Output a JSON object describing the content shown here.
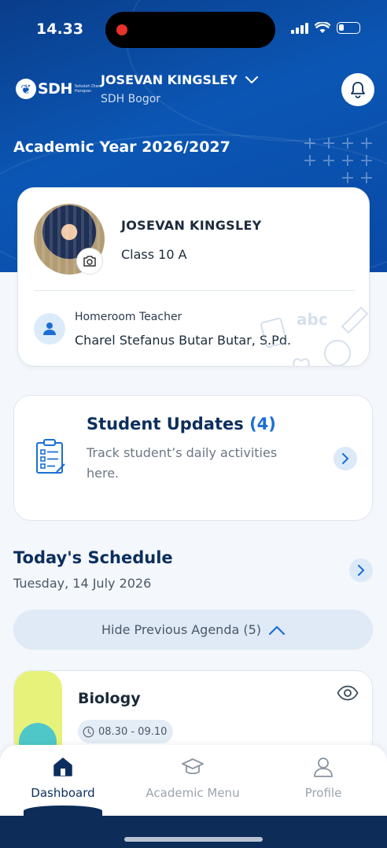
{
  "status_bar": {
    "time": "14.33"
  },
  "header": {
    "school_logo_text": "SDH",
    "school_logo_sub": "Sekolah Dian Harapan",
    "user_name": "JOSEVAN KINGSLEY",
    "school": "SDH Bogor",
    "academic_year": "Academic Year 2026/2027"
  },
  "profile": {
    "name": "JOSEVAN KINGSLEY",
    "class": "Class 10 A",
    "homeroom_label": "Homeroom Teacher",
    "homeroom_teacher": "Charel Stefanus Butar Butar, S.Pd."
  },
  "student_updates": {
    "title": "Student Updates",
    "count": "(4)",
    "description": "Track student’s daily activities here."
  },
  "schedule": {
    "title": "Today's Schedule",
    "date": "Tuesday, 14 July 2026",
    "hide_label": "Hide Previous Agenda (5)",
    "agenda": [
      {
        "subject": "Biology",
        "time": "08.30 - 09.10",
        "accent": "#e7f27a"
      }
    ]
  },
  "bottom_nav": {
    "items": [
      {
        "label": "Dashboard",
        "icon": "home-icon",
        "active": true
      },
      {
        "label": "Academic Menu",
        "icon": "graduation-cap-icon",
        "active": false
      },
      {
        "label": "Profile",
        "icon": "person-icon",
        "active": false
      }
    ]
  },
  "colors": {
    "primary": "#0b56b4",
    "navy": "#0c2e5e",
    "accent_blue": "#1a6fd4"
  }
}
